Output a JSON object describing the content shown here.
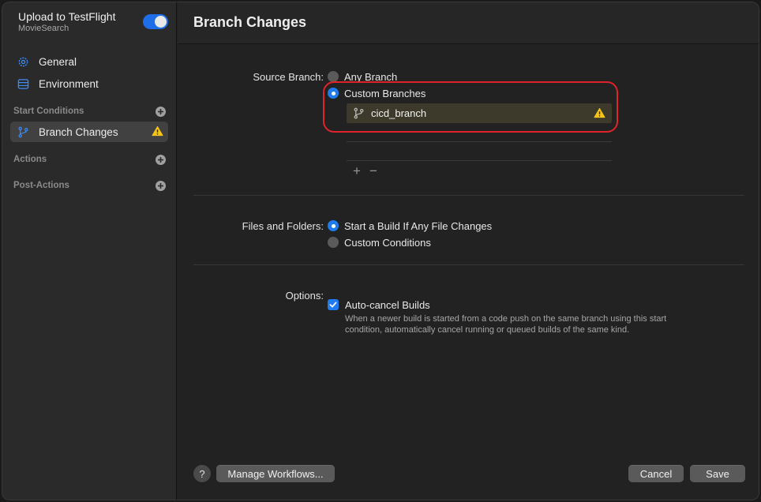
{
  "sidebar": {
    "workflow_title": "Upload to TestFlight",
    "workflow_subtitle": "MovieSearch",
    "enabled": true,
    "items": [
      {
        "label": "General",
        "icon": "gear-icon"
      },
      {
        "label": "Environment",
        "icon": "window-icon"
      }
    ],
    "sections": {
      "start_conditions": "Start Conditions",
      "actions": "Actions",
      "post_actions": "Post-Actions"
    },
    "start_condition_items": [
      {
        "label": "Branch Changes",
        "icon": "branch-icon",
        "warning": true
      }
    ]
  },
  "main": {
    "title": "Branch Changes",
    "source_branch": {
      "label": "Source Branch:",
      "options": [
        "Any Branch",
        "Custom Branches"
      ],
      "selected": "Custom Branches",
      "branches": [
        {
          "name": "cicd_branch",
          "warning": true
        }
      ],
      "add_label": "+",
      "remove_label": "−"
    },
    "files_and_folders": {
      "label": "Files and Folders:",
      "options": [
        "Start a Build If Any File Changes",
        "Custom Conditions"
      ],
      "selected": "Start a Build If Any File Changes"
    },
    "options": {
      "label": "Options:",
      "auto_cancel_label": "Auto-cancel Builds",
      "auto_cancel_checked": true,
      "auto_cancel_desc_line1": "When a newer build is started from a code push on the same branch using this start",
      "auto_cancel_desc_line2": "condition, automatically cancel running or queued builds of the same kind."
    }
  },
  "footer": {
    "help_label": "?",
    "manage_label": "Manage Workflows...",
    "cancel_label": "Cancel",
    "save_label": "Save"
  },
  "colors": {
    "accent": "#1f7cf0",
    "warning": "#f5c518",
    "highlight": "#e0232a"
  }
}
